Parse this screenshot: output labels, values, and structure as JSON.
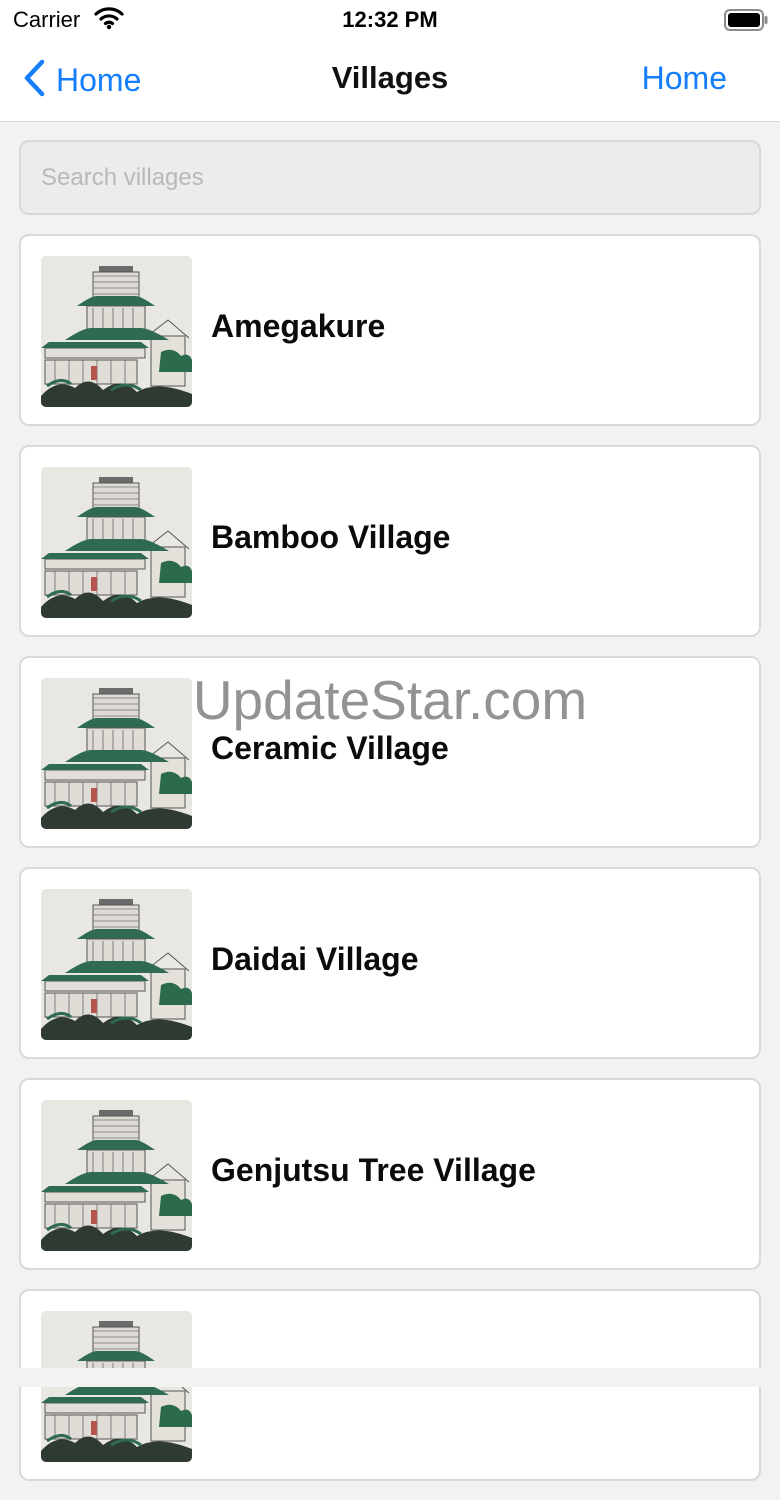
{
  "status_bar": {
    "carrier": "Carrier",
    "time": "12:32 PM"
  },
  "nav": {
    "back_label": "Home",
    "title": "Villages",
    "right_label": "Home"
  },
  "search": {
    "placeholder": "Search villages",
    "value": ""
  },
  "villages": [
    {
      "name": "Amegakure"
    },
    {
      "name": "Bamboo Village"
    },
    {
      "name": "Ceramic Village"
    },
    {
      "name": "Daidai Village"
    },
    {
      "name": "Genjutsu Tree Village"
    },
    {
      "name": ""
    }
  ],
  "watermark": "UpdateStar.com",
  "colors": {
    "accent": "#157efb",
    "roof": "#2e6b52",
    "card_border": "#d9d9d9",
    "background": "#f2f2f2"
  },
  "icons": {
    "back": "chevron-left-icon",
    "wifi": "wifi-icon",
    "battery": "battery-icon",
    "thumbnail": "pagoda-icon"
  }
}
